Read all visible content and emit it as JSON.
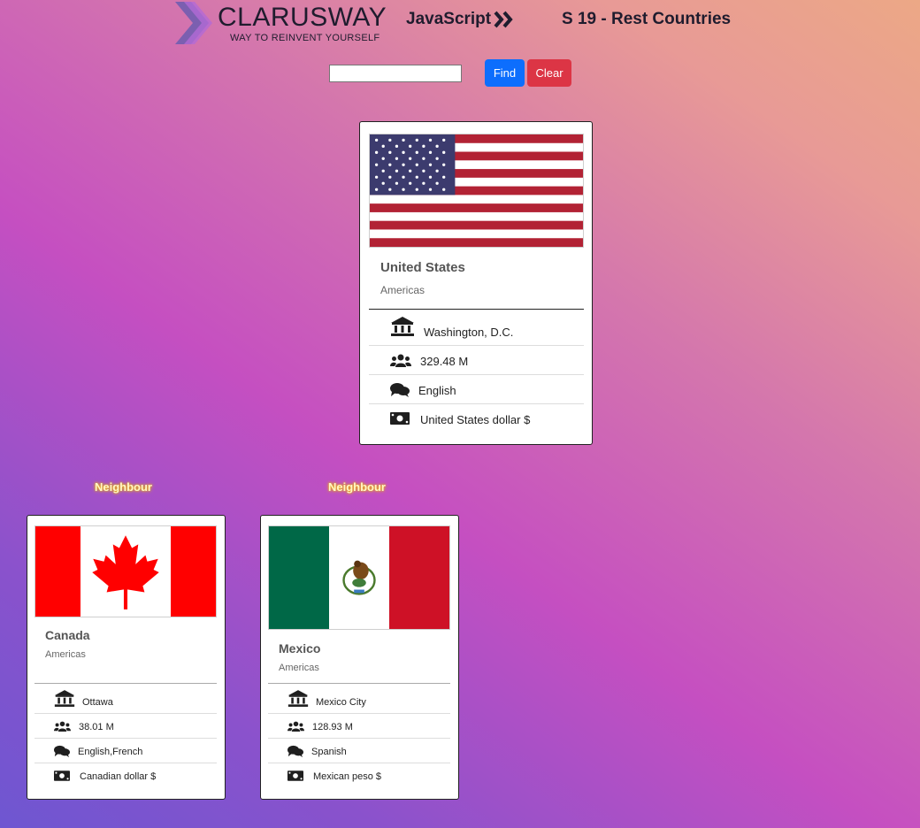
{
  "header": {
    "logo_text": "CLARUSWAY",
    "logo_tagline": "WAY TO REINVENT YOURSELF",
    "course": "JavaScript",
    "session": "S 19 - Rest Countries"
  },
  "search": {
    "value": "",
    "find_label": "Find",
    "clear_label": "Clear"
  },
  "main_country": {
    "name": "United States",
    "region": "Americas",
    "capital": "Washington, D.C.",
    "population": "329.48 M",
    "languages": "English",
    "currency": "United States dollar $"
  },
  "neighbours": [
    {
      "label": "Neighbour",
      "name": "Canada",
      "region": "Americas",
      "capital": "Ottawa",
      "population": "38.01 M",
      "languages": "English,French",
      "currency": "Canadian dollar $"
    },
    {
      "label": "Neighbour",
      "name": "Mexico",
      "region": "Americas",
      "capital": "Mexico City",
      "population": "128.93 M",
      "languages": "Spanish",
      "currency": "Mexican peso $"
    }
  ],
  "colors": {
    "find_button": "#0d6efd",
    "clear_button": "#dc3545",
    "neighbour_glow": "#e6b800"
  }
}
